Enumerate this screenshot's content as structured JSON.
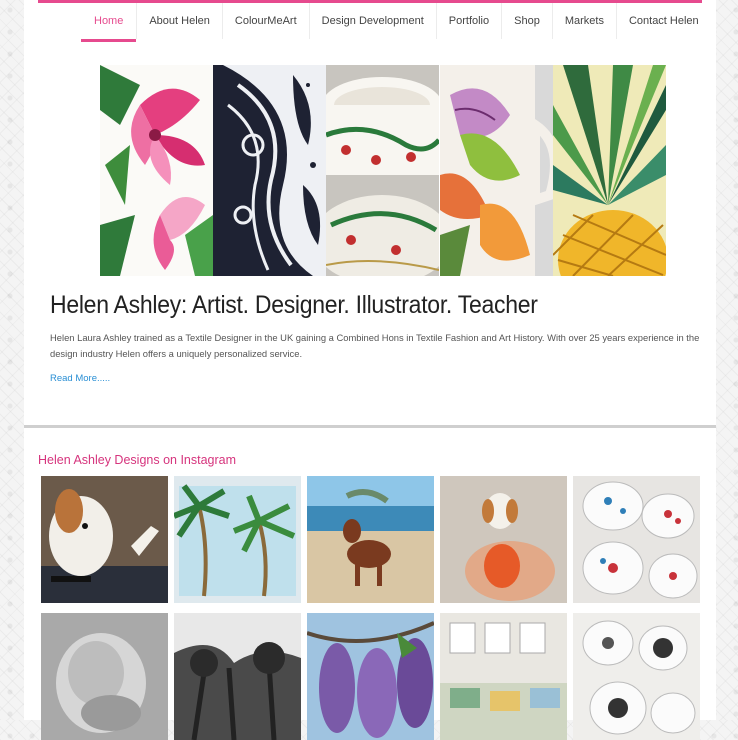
{
  "nav": {
    "items": [
      {
        "label": "Home",
        "active": true
      },
      {
        "label": "About Helen"
      },
      {
        "label": "ColourMeArt"
      },
      {
        "label": "Design Development"
      },
      {
        "label": "Portfolio"
      },
      {
        "label": "Shop"
      },
      {
        "label": "Markets"
      },
      {
        "label": "Contact Helen"
      }
    ]
  },
  "colors": {
    "accent": "#e64a8e",
    "link": "#2a8fd4"
  },
  "hero": {
    "panels": [
      "pink-lily-painting",
      "black-paisley-drawing",
      "floral-teacup",
      "floral-mug",
      "pineapple-illustration"
    ]
  },
  "main": {
    "title": "Helen Ashley:  Artist. Designer. Illustrator. Teacher",
    "description": "Helen Laura Ashley trained as a Textile Designer in the UK gaining a Combined Hons in Textile Fashion and Art History. With over 25 years experience in the design industry Helen offers a uniquely personalized service.",
    "read_more": "Read More....."
  },
  "instagram": {
    "title": "Helen Ashley Designs on Instagram",
    "photos": [
      "dog-with-ceramic-spoon",
      "palm-print-fabric",
      "dog-on-beach",
      "beagle-spoon-in-hand",
      "floral-ceramic-bowls",
      "sleeping-baby",
      "ink-tree-painting",
      "purple-wisteria",
      "market-stall-prints",
      "patterned-ceramic-bowls"
    ]
  }
}
